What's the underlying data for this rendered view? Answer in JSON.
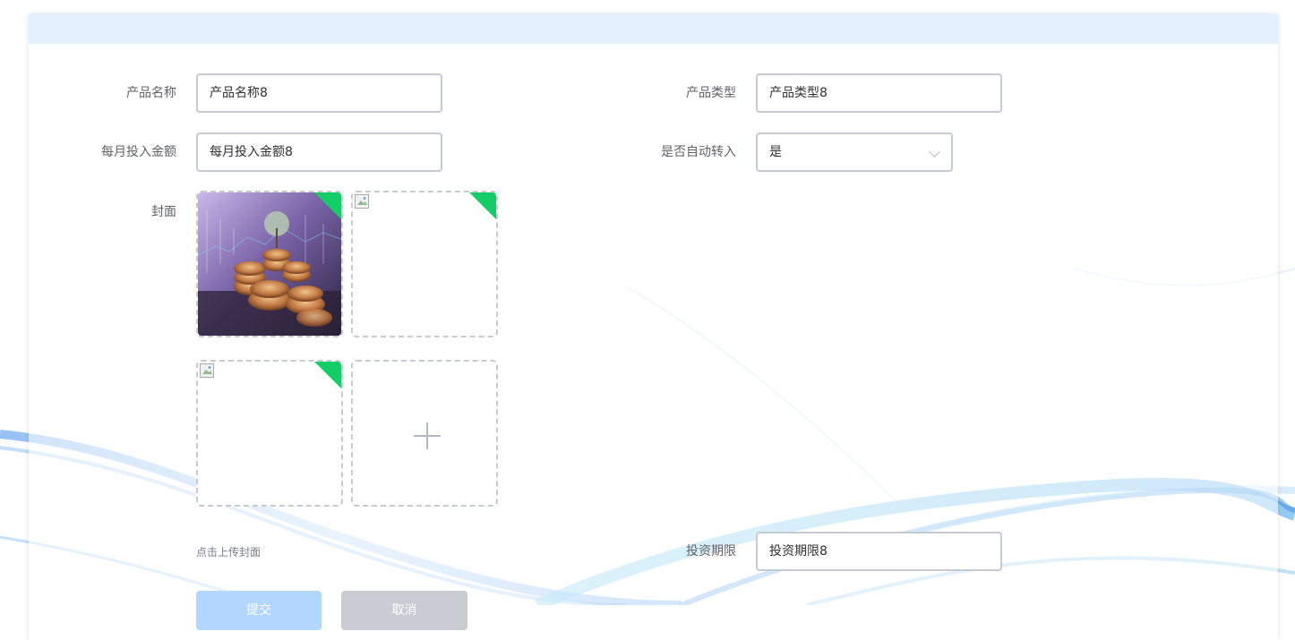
{
  "form": {
    "product_name": {
      "label": "产品名称",
      "value": "产品名称8"
    },
    "product_type": {
      "label": "产品类型",
      "value": "产品类型8"
    },
    "monthly_amount": {
      "label": "每月投入金额",
      "value": "每月投入金额8"
    },
    "auto_transfer": {
      "label": "是否自动转入",
      "value": "是"
    },
    "cover": {
      "label": "封面",
      "tip": "点击上传封面",
      "tiles": [
        {
          "kind": "image",
          "uploaded": true
        },
        {
          "kind": "broken-image",
          "uploaded": true
        },
        {
          "kind": "broken-image",
          "uploaded": true
        },
        {
          "kind": "add",
          "icon": "plus-icon"
        }
      ]
    },
    "investment_period": {
      "label": "投资期限",
      "value": "投资期限8"
    },
    "submit_label": "提交",
    "cancel_label": "取消"
  },
  "colors": {
    "header": "#e3f0fe",
    "uploaded_badge": "#13ce66",
    "input_border": "#c6cad3",
    "submit": "#b3d6fd",
    "cancel": "#c9ccd3"
  }
}
